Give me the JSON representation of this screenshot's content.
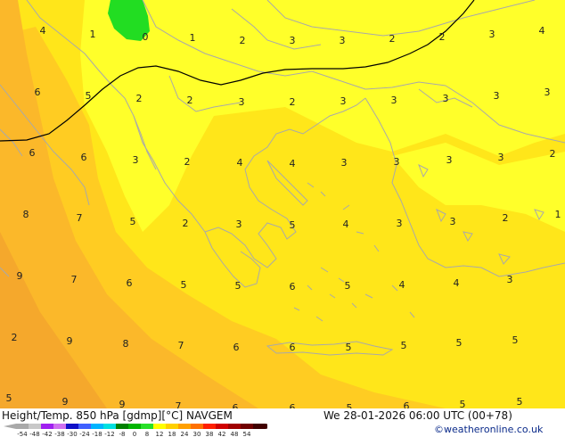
{
  "title": "Height/Temp. 850 hPa [gdmp][°C] NAVGEM",
  "datetime": "We 28-01-2026 06:00 UTC (00+78)",
  "credit": "©weatheronline.co.uk",
  "contour_labels": [
    "4",
    "1",
    "0",
    "1",
    "2",
    "3",
    "3",
    "2",
    "2",
    "3",
    "4",
    "6",
    "5",
    "2",
    "2",
    "3",
    "2",
    "3",
    "3",
    "3",
    "3",
    "3",
    "6",
    "6",
    "3",
    "2",
    "4",
    "4",
    "3",
    "3",
    "3",
    "3",
    "2",
    "8",
    "7",
    "5",
    "2",
    "3",
    "5",
    "4",
    "3",
    "3",
    "2",
    "1",
    "9",
    "7",
    "6",
    "5",
    "5",
    "6",
    "5",
    "4",
    "4",
    "3",
    "2",
    "9",
    "8",
    "7",
    "6",
    "6",
    "5",
    "5",
    "5",
    "5",
    "5",
    "9",
    "9",
    "7",
    "6",
    "6",
    "5",
    "6",
    "5",
    "5",
    "5"
  ],
  "legend": {
    "tick_labels": [
      "-54",
      "-48",
      "-42",
      "-38",
      "-30",
      "-24",
      "-18",
      "-12",
      "-8",
      "0",
      "8",
      "12",
      "18",
      "24",
      "30",
      "38",
      "42",
      "48",
      "54"
    ],
    "colors": [
      "#a9a9a9",
      "#c8c8c8",
      "#a020f0",
      "#d070f0",
      "#1010c8",
      "#4060ff",
      "#00b4ff",
      "#00e0e0",
      "#008000",
      "#00b400",
      "#28e028",
      "#ffff00",
      "#ffd000",
      "#ffa000",
      "#ff7000",
      "#ff2000",
      "#d00000",
      "#a00000",
      "#700000",
      "#400000"
    ]
  },
  "colors": {
    "yellow_bright": "#ffff2a",
    "yellow_mid": "#ffe61a",
    "orange_light": "#ffcc22",
    "orange": "#fbb82a",
    "green_cell": "#22dd22",
    "coastline": "#a9a9a9",
    "isotherm": "#000000"
  }
}
